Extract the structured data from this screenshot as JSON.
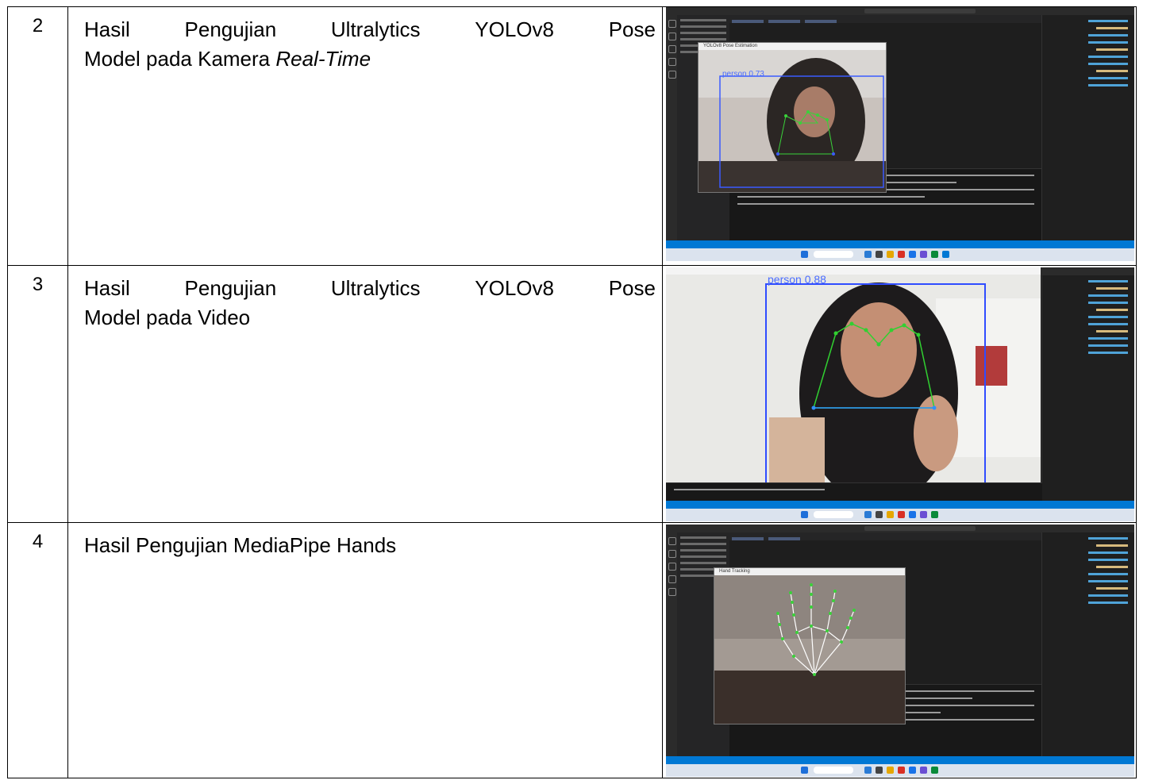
{
  "rows": [
    {
      "number": "2",
      "title_line1": [
        "Hasil",
        "Pengujian",
        "Ultralytics",
        "YOLOv8",
        "Pose"
      ],
      "title_line2_plain": "Model pada Kamera ",
      "title_line2_italic": "Real-Time",
      "screenshot": {
        "window_title": "YOLOv8 Pose Estimation",
        "label": "person 0.73"
      }
    },
    {
      "number": "3",
      "title_line1": [
        "Hasil",
        "Pengujian",
        "Ultralytics",
        "YOLOv8",
        "Pose"
      ],
      "title_line2_plain": "Model pada Video",
      "title_line2_italic": "",
      "screenshot": {
        "window_title": "",
        "label": "person 0.88"
      }
    },
    {
      "number": "4",
      "title_line1": [
        "Hasil",
        "Pengujian",
        "MediaPipe",
        "Hands"
      ],
      "title_line2_plain": "",
      "title_line2_italic": "",
      "screenshot": {
        "window_title": "Hand Tracking",
        "label": ""
      }
    }
  ]
}
